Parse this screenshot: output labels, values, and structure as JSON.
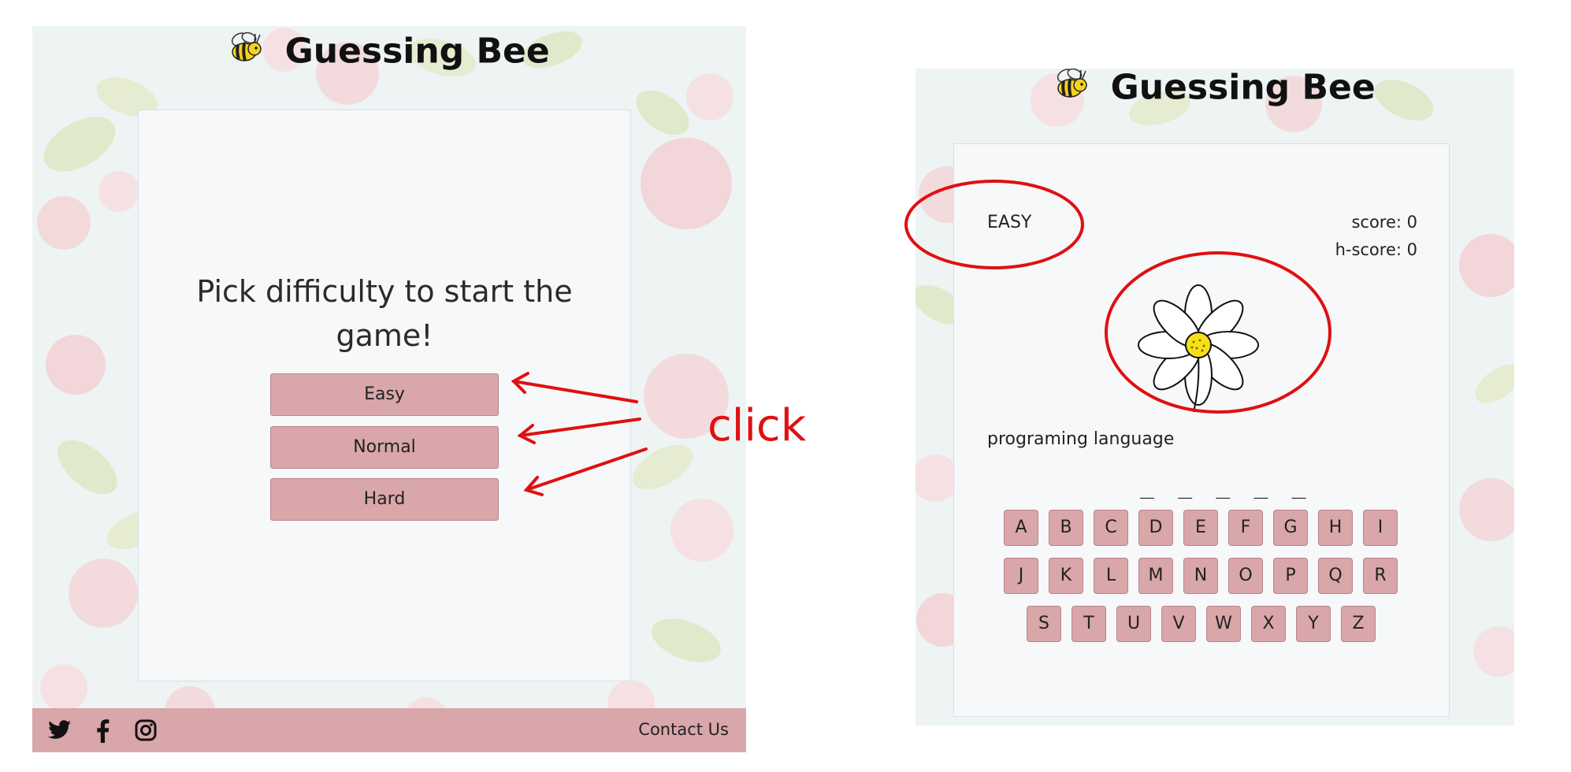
{
  "site": {
    "title": "Guessing Bee"
  },
  "start_screen": {
    "prompt_line1": "Pick difficulty to start the",
    "prompt_line2": "game!",
    "buttons": [
      {
        "label": "Easy"
      },
      {
        "label": "Normal"
      },
      {
        "label": "Hard"
      }
    ],
    "footer": {
      "social_icons": [
        "twitter-icon",
        "facebook-icon",
        "instagram-icon"
      ],
      "contact_label": "Contact Us"
    }
  },
  "annotation": {
    "label": "click",
    "color": "#e01010"
  },
  "game_screen": {
    "level": "EASY",
    "score_label": "score: 0",
    "high_score_label": "h-score: 0",
    "hint": "programing language",
    "blanks": "_ _ _ _ _",
    "keyboard_rows": [
      [
        "A",
        "B",
        "C",
        "D",
        "E",
        "F",
        "G",
        "H",
        "I"
      ],
      [
        "J",
        "K",
        "L",
        "M",
        "N",
        "O",
        "P",
        "Q",
        "R"
      ],
      [
        "S",
        "T",
        "U",
        "V",
        "W",
        "X",
        "Y",
        "Z"
      ]
    ]
  },
  "colors": {
    "button": "#d9a6aa",
    "footer": "#d9a6aa",
    "card": "#f6f8f9",
    "annotation": "#e01010"
  }
}
